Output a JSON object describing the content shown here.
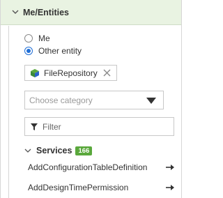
{
  "header": {
    "title": "Me/Entities",
    "chevron_icon": "chevron-down-icon"
  },
  "entity_choice": {
    "options": [
      {
        "label": "Me",
        "checked": false
      },
      {
        "label": "Other entity",
        "checked": true
      }
    ]
  },
  "selected_entity": {
    "label": "FileRepository",
    "icon": "cube-icon",
    "close_icon": "close-icon"
  },
  "category_select": {
    "placeholder": "Choose category",
    "caret_icon": "caret-down-icon"
  },
  "filter": {
    "placeholder": "Filter",
    "value": "",
    "icon": "funnel-icon"
  },
  "services": {
    "title": "Services",
    "count": "166",
    "chevron_icon": "chevron-down-icon",
    "items": [
      {
        "label": "AddConfigurationTableDefinition",
        "icon": "arrow-right-icon"
      },
      {
        "label": "AddDesignTimePermission",
        "icon": "arrow-right-icon"
      }
    ]
  },
  "colors": {
    "header_bg": "#e9f3e2",
    "accent_blue": "#1f6ed6",
    "badge_green": "#5aa83c",
    "cube_green": "#3c8a3a",
    "cube_blue": "#2b62c8"
  }
}
